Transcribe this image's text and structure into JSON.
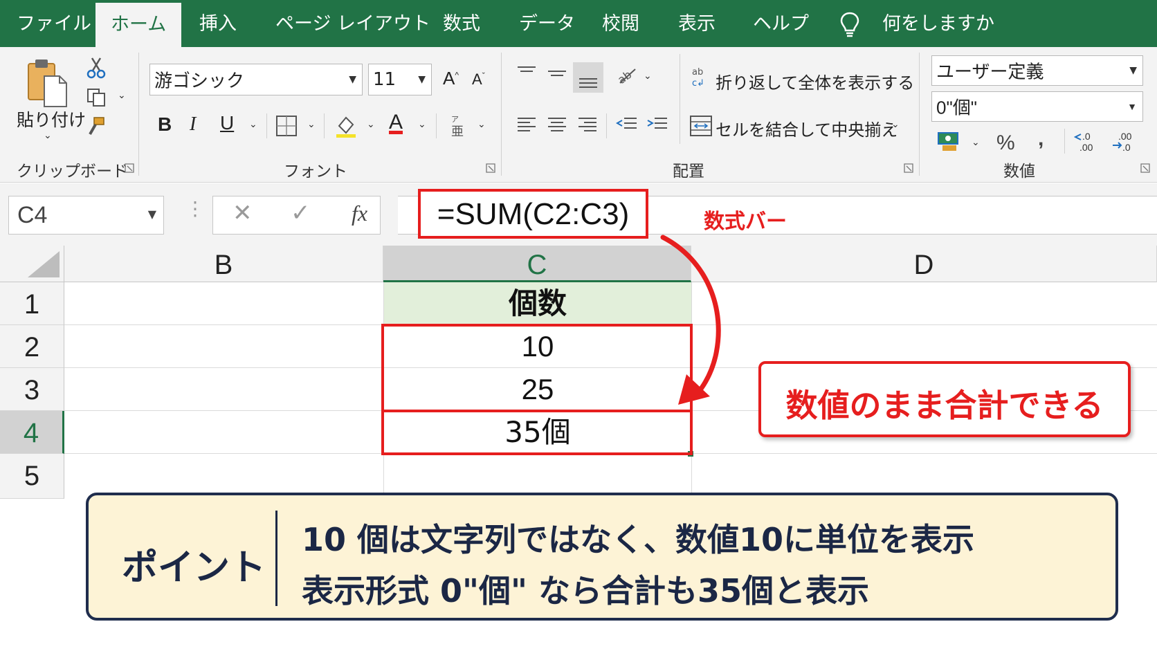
{
  "ribbon_tabs": [
    "ファイル",
    "ホーム",
    "挿入",
    "ページ レイアウト",
    "数式",
    "データ",
    "校閲",
    "表示",
    "ヘルプ"
  ],
  "tell_me": "何をしますか",
  "clipboard": {
    "paste_label": "貼り付け",
    "group_label": "クリップボード"
  },
  "font": {
    "name": "游ゴシック",
    "size": "11",
    "group_label": "フォント",
    "bold": "B",
    "italic": "I",
    "underline": "U"
  },
  "alignment": {
    "wrap_label": "折り返して全体を表示する",
    "merge_label": "セルを結合して中央揃え",
    "group_label": "配置"
  },
  "number": {
    "format": "ユーザー定義",
    "custom_format": "0\"個\"",
    "percent": "%",
    "comma": ",",
    "group_label": "数値"
  },
  "formula_bar": {
    "name_box": "C4",
    "formula": "=SUM(C2:C3)",
    "fx": "fx",
    "annotation": "数式バー"
  },
  "sheet": {
    "columns": [
      "B",
      "C",
      "D"
    ],
    "rows": [
      "1",
      "2",
      "3",
      "4",
      "5"
    ],
    "c1": "個数",
    "c2": "10",
    "c3": "25",
    "c4": "35個"
  },
  "callout_right": "数値のまま合計できる",
  "point": {
    "label": "ポイント",
    "line1": "10 個は文字列ではなく、数値10に単位を表示",
    "line2": "表示形式 0\"個\" なら合計も35個と表示"
  },
  "colors": {
    "excel_green": "#217346",
    "annotation_red": "#e61e1e",
    "header_fill": "#e2efda",
    "point_bg": "#fdf3d6",
    "point_border": "#1f2d4d"
  }
}
